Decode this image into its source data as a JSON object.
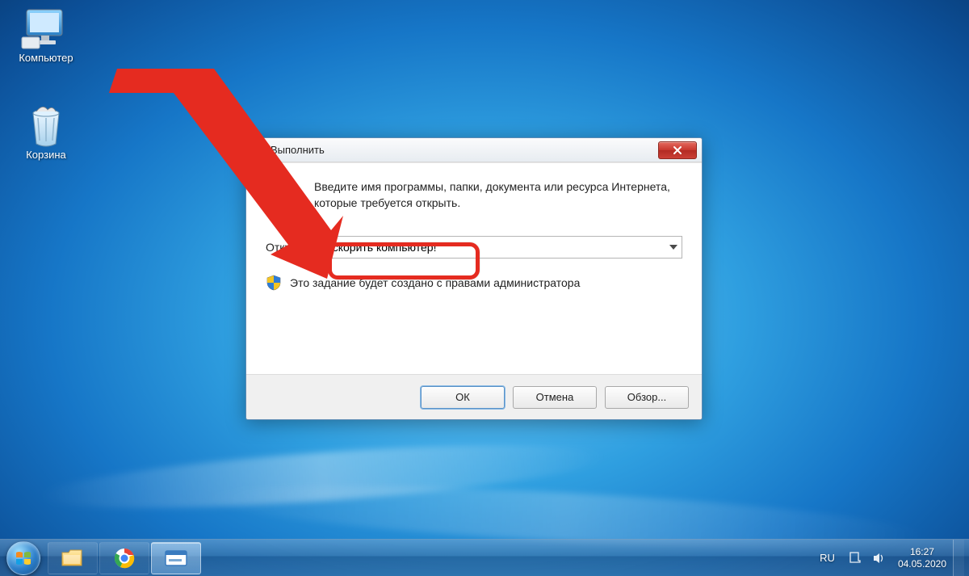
{
  "desktop": {
    "icons": {
      "computer": {
        "label": "Компьютер"
      },
      "recycle_bin": {
        "label": "Корзина"
      }
    }
  },
  "run_dialog": {
    "title": "Выполнить",
    "description": "Введите имя программы, папки, документа или ресурса Интернета, которые требуется открыть.",
    "open_label": "Открыть:",
    "open_value": "ускорить компьютер!",
    "admin_note": "Это задание будет создано с правами администратора",
    "buttons": {
      "ok": "ОК",
      "cancel": "Отмена",
      "browse": "Обзор..."
    }
  },
  "taskbar": {
    "language": "RU",
    "time": "16:27",
    "date": "04.05.2020"
  },
  "colors": {
    "annotation_red": "#e52b20"
  }
}
